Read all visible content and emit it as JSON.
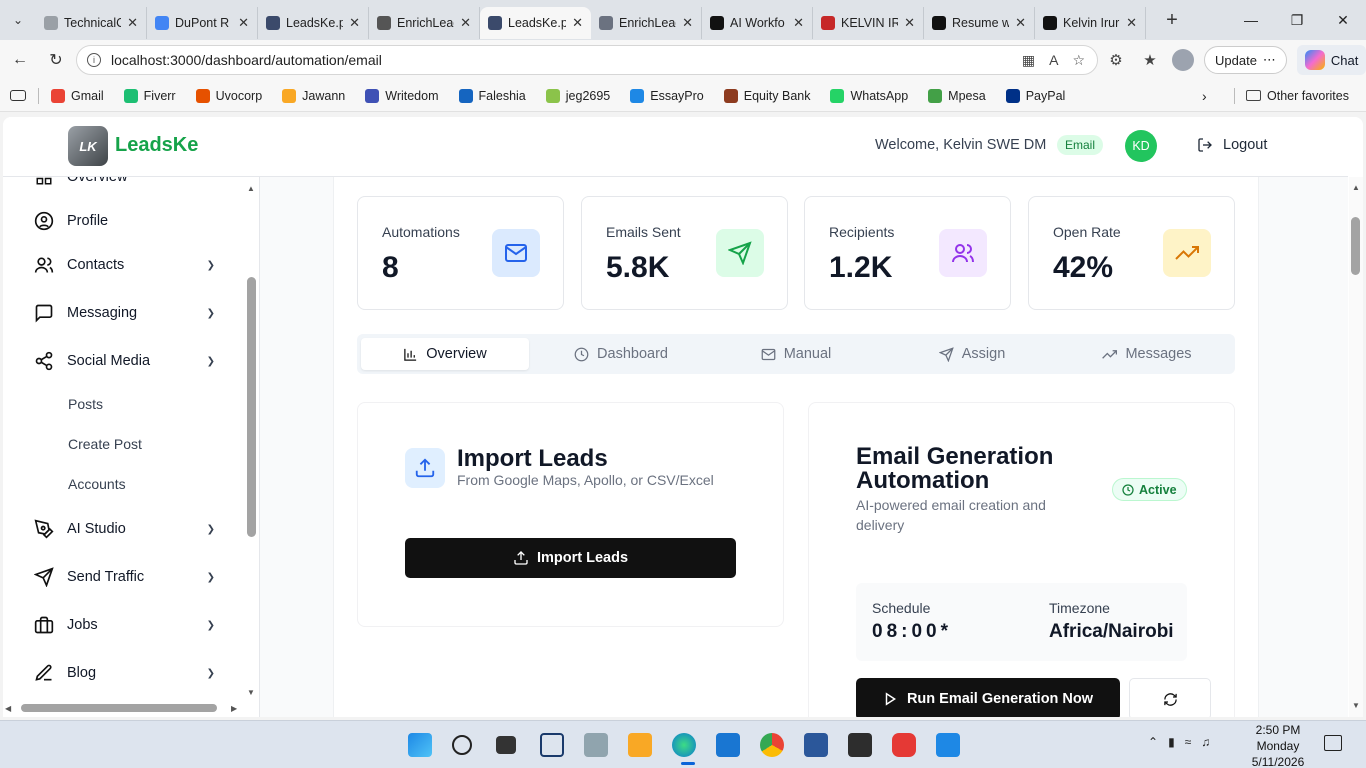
{
  "browser": {
    "tabs": [
      {
        "label": "TechnicalC",
        "color": "#9aa0a6"
      },
      {
        "label": "DuPont R",
        "color": "#4285f4"
      },
      {
        "label": "LeadsKe.p",
        "color": "#3b4a6b"
      },
      {
        "label": "EnrichLead",
        "color": "#555555"
      },
      {
        "label": "LeadsKe.p",
        "color": "#3b4a6b",
        "active": true
      },
      {
        "label": "EnrichLead",
        "color": "#6b7280"
      },
      {
        "label": "AI Workfo",
        "color": "#111111"
      },
      {
        "label": "KELVIN IRI",
        "color": "#c62828"
      },
      {
        "label": "Resume w",
        "color": "#111111"
      },
      {
        "label": "Kelvin Irur",
        "color": "#111111"
      }
    ],
    "url": "localhost:3000/dashboard/automation/email",
    "update_label": "Update",
    "chat_label": "Chat",
    "bookmarks": [
      {
        "label": "Gmail",
        "color": "#ea4335"
      },
      {
        "label": "Fiverr",
        "color": "#1dbf73"
      },
      {
        "label": "Uvocorp",
        "color": "#e65100"
      },
      {
        "label": "Jawann",
        "color": "#f9a825"
      },
      {
        "label": "Writedom",
        "color": "#3f51b5"
      },
      {
        "label": "Faleshia",
        "color": "#1565c0"
      },
      {
        "label": "jeg2695",
        "color": "#8bc34a"
      },
      {
        "label": "EssayPro",
        "color": "#1e88e5"
      },
      {
        "label": "Equity Bank",
        "color": "#8d3b1f"
      },
      {
        "label": "WhatsApp",
        "color": "#25d366"
      },
      {
        "label": "Mpesa",
        "color": "#43a047"
      },
      {
        "label": "PayPal",
        "color": "#003087"
      }
    ],
    "other_favorites": "Other favorites"
  },
  "header": {
    "brand": "LeadsKe",
    "logo_text": "LK",
    "welcome": "Welcome, Kelvin SWE DM",
    "badge": "Email",
    "avatar": "KD",
    "logout": "Logout"
  },
  "sidebar": {
    "items": [
      {
        "label": "Overview"
      },
      {
        "label": "Profile"
      },
      {
        "label": "Contacts"
      },
      {
        "label": "Messaging"
      },
      {
        "label": "Social Media"
      },
      {
        "label": "AI Studio"
      },
      {
        "label": "Send Traffic"
      },
      {
        "label": "Jobs"
      },
      {
        "label": "Blog"
      }
    ],
    "sub_items": [
      "Posts",
      "Create Post",
      "Accounts"
    ]
  },
  "stats": [
    {
      "label": "Automations",
      "value": "8",
      "bg": "#dbeafe",
      "fg": "#2563eb"
    },
    {
      "label": "Emails Sent",
      "value": "5.8K",
      "bg": "#dcfce7",
      "fg": "#16a34a"
    },
    {
      "label": "Recipients",
      "value": "1.2K",
      "bg": "#f3e8ff",
      "fg": "#9333ea"
    },
    {
      "label": "Open Rate",
      "value": "42%",
      "bg": "#fef3c7",
      "fg": "#d97706"
    }
  ],
  "tabs": [
    "Overview",
    "Dashboard",
    "Manual",
    "Assign",
    "Messages"
  ],
  "import": {
    "title": "Import Leads",
    "subtitle": "From Google Maps, Apollo, or CSV/Excel",
    "button": "Import Leads"
  },
  "email_gen": {
    "title": "Email Generation Automation",
    "subtitle": "AI-powered email creation and delivery",
    "status": "Active",
    "schedule_label": "Schedule",
    "schedule_value": "08:00*",
    "timezone_label": "Timezone",
    "timezone_value": "Africa/Nairobi",
    "run_button": "Run Email Generation Now"
  },
  "taskbar": {
    "time": "2:50 PM",
    "day": "Monday",
    "date": "5/11/2026"
  }
}
